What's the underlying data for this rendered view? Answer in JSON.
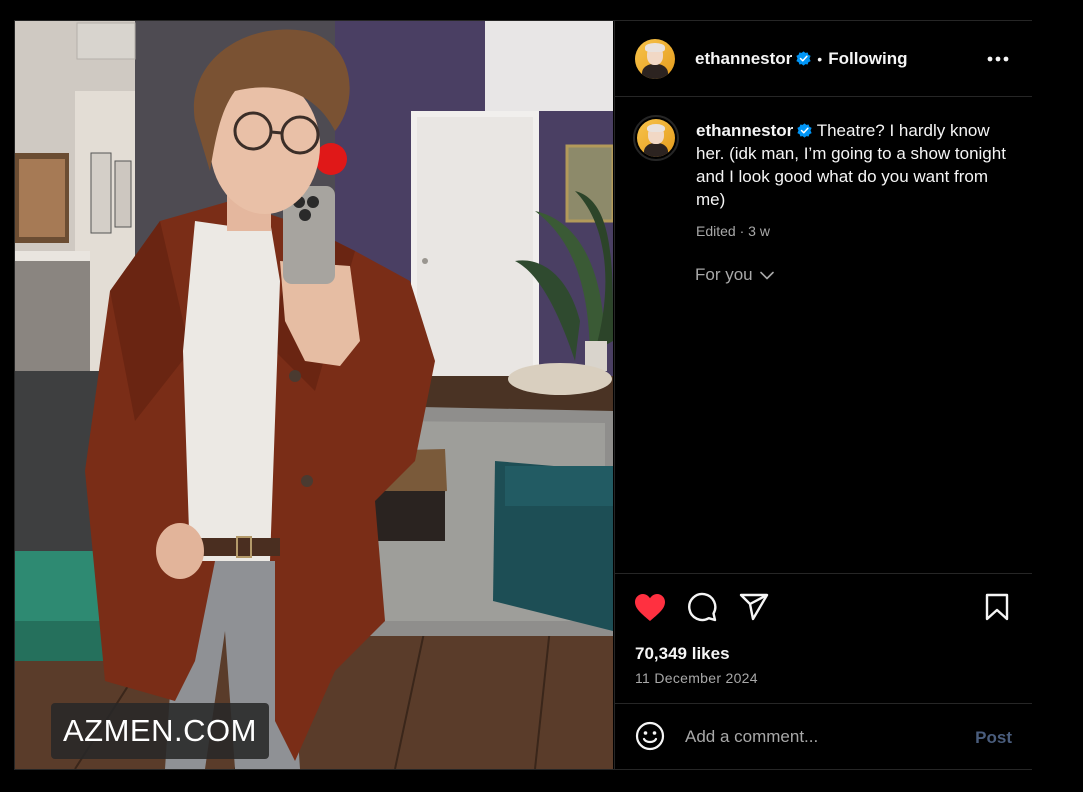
{
  "post": {
    "username": "ethannestor",
    "verified": true,
    "separator": "•",
    "follow_status": "Following",
    "caption_text": "Theatre? I hardly know her. (idk man, I’m going to a show tonight and I look good what do you want from me)",
    "caption_meta": "Edited · 3 w",
    "for_you_label": "For you",
    "likes": "70,349 likes",
    "date": "11 December 2024",
    "liked": true
  },
  "photo": {
    "watermark": "AZMEN.COM",
    "alt_subject": "mirror selfie of man in brown coat"
  },
  "comment": {
    "placeholder": "Add a comment...",
    "post_label": "Post"
  },
  "icons": {
    "more": "more-options-icon",
    "like": "heart-icon",
    "comment": "comment-bubble-icon",
    "share": "paper-plane-icon",
    "save": "bookmark-icon",
    "emoji": "smiley-icon",
    "verified": "verified-badge-icon",
    "dropdown": "chevron-down-icon"
  },
  "colors": {
    "background": "#000000",
    "text": "#f5f5f5",
    "muted": "#a8a8a8",
    "like_red": "#ff3040",
    "verified_blue": "#0095f6",
    "post_disabled": "#4a5d7d",
    "divider": "#262626"
  }
}
